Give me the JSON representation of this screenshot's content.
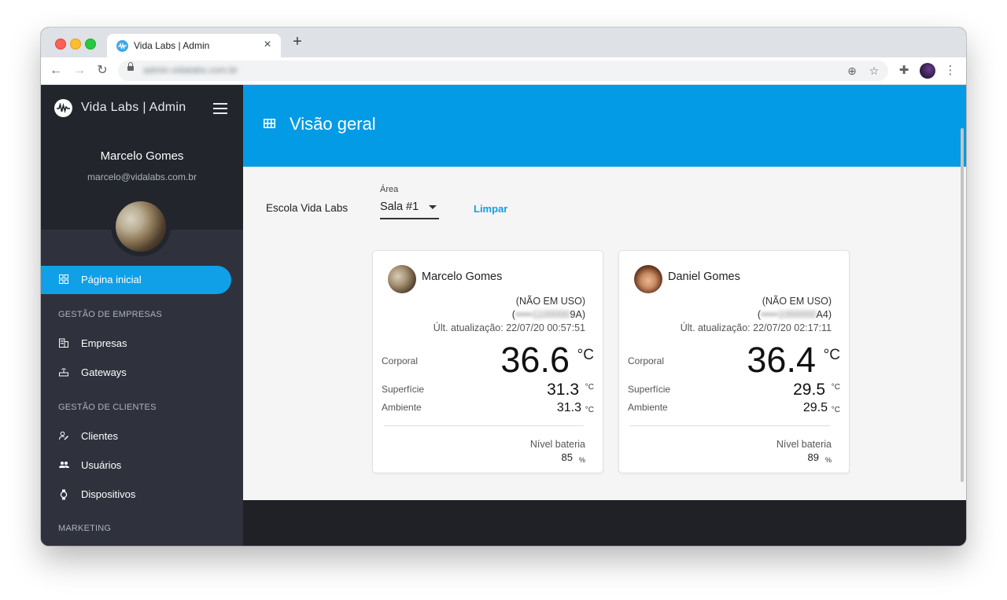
{
  "browser": {
    "tab_title": "Vida Labs | Admin",
    "tab_close": "×",
    "new_tab": "+",
    "url": "admin.vidalabs.com.br",
    "nav": {
      "back": "←",
      "forward": "→",
      "reload": "↻"
    },
    "icons": [
      "add-circle-icon",
      "star-icon",
      "extension-icon",
      "profile-avatar",
      "more-vert-icon"
    ]
  },
  "sidebar": {
    "brand": "Vida Labs | Admin",
    "user_name": "Marcelo Gomes",
    "user_email": "marcelo@vidalabs.com.br",
    "active_item": {
      "label": "Página inicial",
      "icon": "dashboard-icon"
    },
    "sections": [
      {
        "heading": "GESTÃO DE EMPRESAS",
        "items": [
          {
            "label": "Empresas",
            "icon": "building-icon"
          },
          {
            "label": "Gateways",
            "icon": "router-icon"
          }
        ]
      },
      {
        "heading": "GESTÃO DE CLIENTES",
        "items": [
          {
            "label": "Clientes",
            "icon": "person-edit-icon"
          },
          {
            "label": "Usuários",
            "icon": "people-icon"
          },
          {
            "label": "Dispositivos",
            "icon": "watch-icon"
          }
        ]
      },
      {
        "heading": "MARKETING",
        "items": []
      }
    ],
    "colors": {
      "accent": "#0fa0e8",
      "top_bg": "#22252c",
      "bg": "#2f323d"
    }
  },
  "main": {
    "title": "Visão geral",
    "title_icon": "grid-icon",
    "header_color": "#039be5",
    "filters": {
      "school": "Escola Vida Labs",
      "area_label": "Área",
      "area_value": "Sala #1",
      "clear_label": "Limpar"
    },
    "cards": [
      {
        "name": "Marcelo Gomes",
        "status": "(NÃO EM USO)",
        "device_prefix": "(",
        "device_masked": "•••••1100000",
        "device_suffix": "9A)",
        "updated": "Últ. atualização: 22/07/20 00:57:51",
        "body_label": "Corporal",
        "body_temp": "36.6",
        "surface_label": "Superfície",
        "surface_temp": "31.3",
        "ambient_label": "Ambiente",
        "ambient_temp": "31.3",
        "unit": "°C",
        "battery_label": "Nível bateria",
        "battery": "85",
        "battery_unit": "%"
      },
      {
        "name": "Daniel Gomes",
        "status": "(NÃO EM USO)",
        "device_prefix": "(",
        "device_masked": "•••••1000000",
        "device_suffix": "A4)",
        "updated": "Últ. atualização: 22/07/20 02:17:11",
        "body_label": "Corporal",
        "body_temp": "36.4",
        "surface_label": "Superfície",
        "surface_temp": "29.5",
        "ambient_label": "Ambiente",
        "ambient_temp": "29.5",
        "unit": "°C",
        "battery_label": "Nível bateria",
        "battery": "89",
        "battery_unit": "%"
      }
    ]
  }
}
